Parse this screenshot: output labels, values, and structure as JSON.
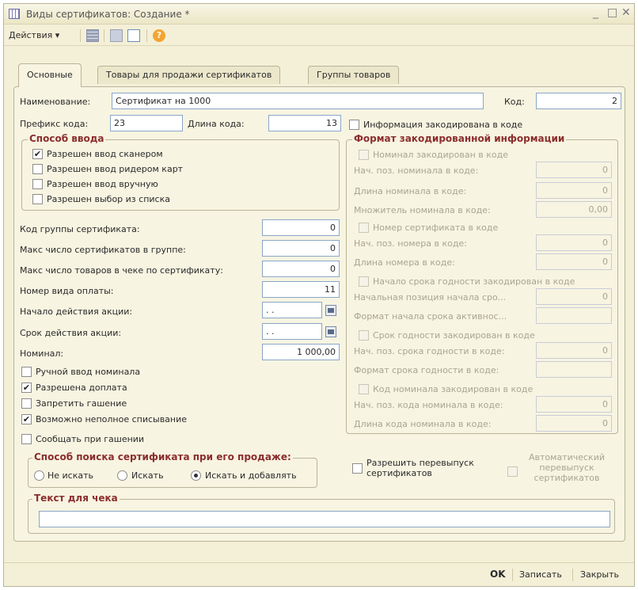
{
  "window": {
    "title": "Виды сертификатов: Создание *",
    "controls": {
      "minimize": "_",
      "maximize": "□",
      "close": "✕"
    }
  },
  "toolbar": {
    "actions_label": "Действия ▾",
    "icons": [
      "grid-icon",
      "cards-icon",
      "document-icon",
      "help-icon"
    ]
  },
  "tabs": [
    {
      "label": "Основные",
      "active": true
    },
    {
      "label": "Товары для продажи сертификатов",
      "active": false
    },
    {
      "label": "Группы товаров",
      "active": false
    }
  ],
  "form": {
    "name_label": "Наименование:",
    "name_value": "Сертификат на 1000",
    "code_label": "Код:",
    "code_value": "2",
    "prefix_label": "Префикс кода:",
    "prefix_value": "23",
    "code_length_label": "Длина кода:",
    "code_length_value": "13",
    "input_method": {
      "title": "Способ ввода",
      "options": [
        {
          "label": "Разрешен ввод сканером",
          "checked": true
        },
        {
          "label": "Разрешен ввод ридером карт",
          "checked": false
        },
        {
          "label": "Разрешен ввод вручную",
          "checked": false
        },
        {
          "label": "Разрешен выбор из списка",
          "checked": false
        }
      ]
    },
    "fields": [
      {
        "label": "Код группы сертификата:",
        "value": "0"
      },
      {
        "label": "Макс число сертификатов в группе:",
        "value": "0"
      },
      {
        "label": "Макс число товаров в чеке по сертификату:",
        "value": "0"
      },
      {
        "label": "Номер вида оплаты:",
        "value": "11"
      },
      {
        "label": "Начало действия акции:",
        "value": ". ."
      },
      {
        "label": "Срок действия акции:",
        "value": ". ."
      },
      {
        "label": "Номинал:",
        "value": "1 000,00"
      }
    ],
    "checkboxes": [
      {
        "label": "Ручной ввод номинала",
        "checked": false
      },
      {
        "label": "Разрешена доплата",
        "checked": true
      },
      {
        "label": "Запретить гашение",
        "checked": false
      },
      {
        "label": "Возможно неполное списывание",
        "checked": true
      },
      {
        "label": "Сообщать при гашении",
        "checked": false
      }
    ],
    "search_method": {
      "title": "Способ поиска сертификата при его продаже:",
      "options": [
        {
          "label": "Не искать",
          "selected": false
        },
        {
          "label": "Искать",
          "selected": false
        },
        {
          "label": "Искать и добавлять",
          "selected": true
        }
      ]
    },
    "reissue": {
      "allow_label": "Разрешить перевыпуск сертификатов",
      "allow_checked": false,
      "auto_label": "Автоматический перевыпуск сертификатов",
      "auto_checked": false
    },
    "receipt_text": {
      "title": "Текст для чека",
      "value": ""
    },
    "encoded_info_label": "Информация закодирована в коде",
    "encoded_info_checked": false,
    "encoded_format": {
      "title": "Формат закодированной информации",
      "rows": [
        {
          "type": "checkbox",
          "label": "Номинал закодирован в коде"
        },
        {
          "type": "field",
          "label": "Нач. поз. номинала в коде:",
          "value": "0"
        },
        {
          "type": "field",
          "label": "Длина номинала в коде:",
          "value": "0"
        },
        {
          "type": "field",
          "label": "Множитель номинала в коде:",
          "value": "0,00"
        },
        {
          "type": "checkbox",
          "label": "Номер сертификата в коде"
        },
        {
          "type": "field",
          "label": "Нач. поз. номера в коде:",
          "value": "0"
        },
        {
          "type": "field",
          "label": "Длина номера в коде:",
          "value": "0"
        },
        {
          "type": "checkbox",
          "label": "Начало срока годности закодирован в коде"
        },
        {
          "type": "field",
          "label": "Начальная позиция начала сро...",
          "value": "0"
        },
        {
          "type": "field",
          "label": "Формат начала срока активнос...",
          "value": ""
        },
        {
          "type": "checkbox",
          "label": "Срок годности закодирован в коде"
        },
        {
          "type": "field",
          "label": "Нач. поз. срока годности в коде:",
          "value": "0"
        },
        {
          "type": "field",
          "label": "Формат срока годности в коде:",
          "value": ""
        },
        {
          "type": "checkbox",
          "label": "Код номинала закодирован в коде"
        },
        {
          "type": "field",
          "label": "Нач. поз. кода номинала в коде:",
          "value": "0"
        },
        {
          "type": "field",
          "label": "Длина кода номинала в коде:",
          "value": "0"
        }
      ]
    }
  },
  "footer": {
    "ok_label": "OK",
    "save_label": "Записать",
    "close_label": "Закрыть"
  }
}
